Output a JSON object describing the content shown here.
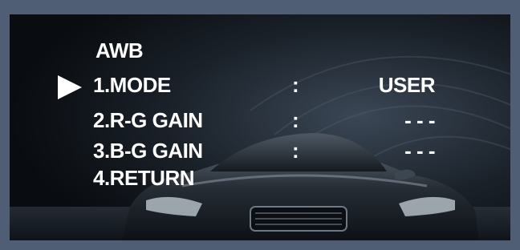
{
  "menu": {
    "title": "AWB",
    "items": [
      {
        "label": "1.MODE",
        "separator": ":",
        "value": "USER",
        "selected": true
      },
      {
        "label": "2.R-G GAIN",
        "separator": ":",
        "value": "- - -",
        "selected": false
      },
      {
        "label": "3.B-G GAIN",
        "separator": ":",
        "value": "- - -",
        "selected": false
      },
      {
        "label": "4.RETURN",
        "separator": "",
        "value": "",
        "selected": false
      }
    ]
  },
  "colors": {
    "border": "#4f5d75",
    "text": "#ffffff",
    "background": "#0f141b"
  },
  "icons": {
    "cursor": "selection-arrow-icon"
  }
}
